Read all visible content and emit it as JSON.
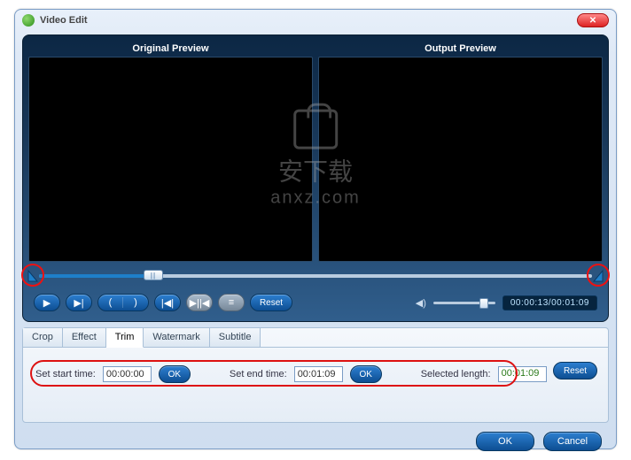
{
  "title": "Video Edit",
  "previews": {
    "original": "Original Preview",
    "output": "Output Preview"
  },
  "watermark": {
    "line1": "安下载",
    "line2": "anxz.com"
  },
  "timeline": {
    "thumb_glyph": "||"
  },
  "controls": {
    "play": "▶",
    "next": "▶|",
    "in": "(",
    "out": ")",
    "step": "|◀|",
    "prevnext": "▶||◀",
    "center": "≡",
    "reset": "Reset"
  },
  "volume": {
    "icon": "◀)"
  },
  "time_display": "00:00:13/00:01:09",
  "tabs": [
    "Crop",
    "Effect",
    "Trim",
    "Watermark",
    "Subtitle"
  ],
  "active_tab": "Trim",
  "trim": {
    "start_label": "Set start time:",
    "start_value": "00:00:00",
    "end_label": "Set end time:",
    "end_value": "00:01:09",
    "sel_label": "Selected length:",
    "sel_value": "00:01:09",
    "ok": "OK",
    "reset": "Reset"
  },
  "footer": {
    "ok": "OK",
    "cancel": "Cancel"
  }
}
